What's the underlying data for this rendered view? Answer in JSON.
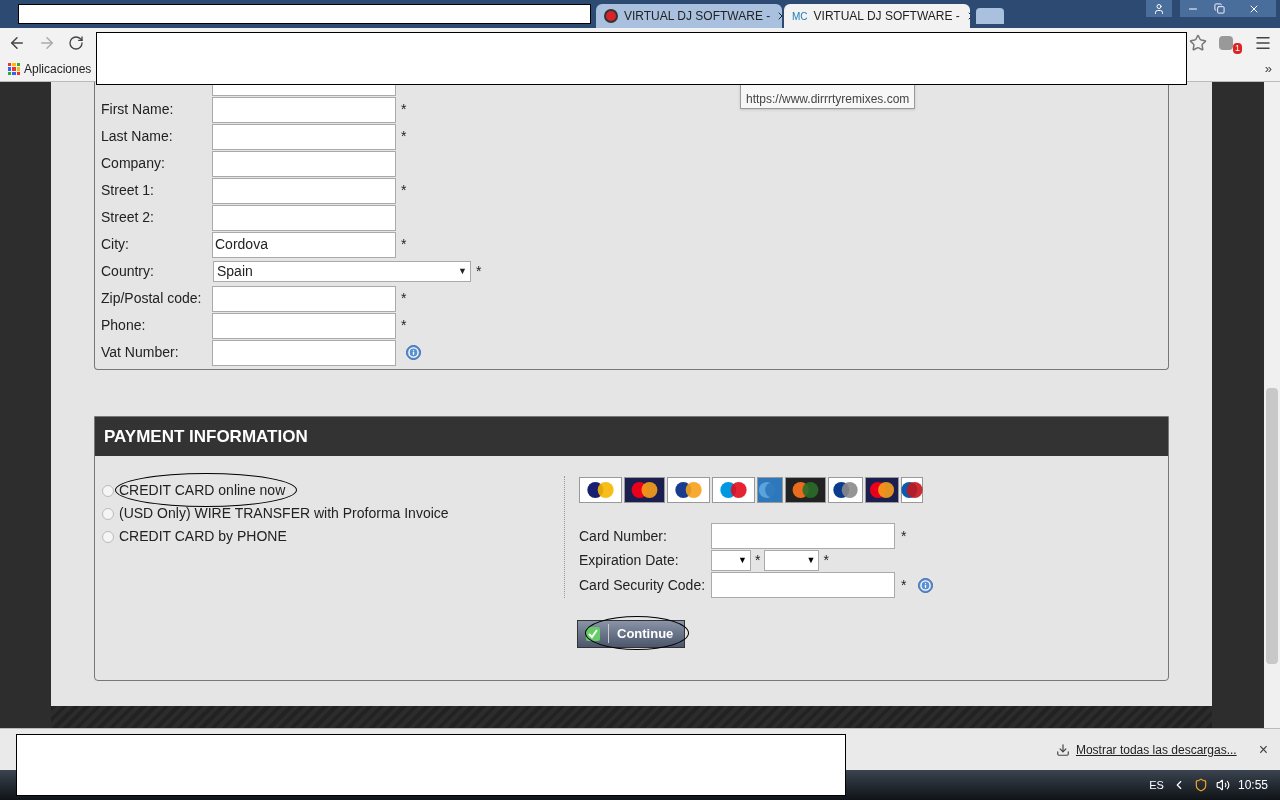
{
  "browser": {
    "tabs": [
      {
        "title": "VIRTUAL DJ SOFTWARE - ",
        "selected": false
      },
      {
        "title": "VIRTUAL DJ SOFTWARE - ",
        "favicon_text": "MC",
        "selected": true
      }
    ],
    "bookmarks": [
      {
        "label": "Aplicaciones"
      }
    ],
    "more": "»",
    "badge": "1"
  },
  "tooltip": {
    "lines": [
      "https://www.dirrrtyremixes.com"
    ]
  },
  "billing": {
    "fields": [
      {
        "label": "First Name:",
        "kind": "text",
        "mark": "*",
        "info": false
      },
      {
        "label": "Last Name:",
        "kind": "text",
        "mark": "*",
        "info": false
      },
      {
        "label": "Company:",
        "kind": "text",
        "info": false
      },
      {
        "label": "Street 1:",
        "kind": "text",
        "mark": "*",
        "info": false
      },
      {
        "label": "Street 2:",
        "kind": "text",
        "info": false
      },
      {
        "label": "City:",
        "kind": "text",
        "value": "Cordova",
        "mark": "*",
        "info": false
      },
      {
        "label": "Country:",
        "kind": "select",
        "value": "Spain",
        "arrows": [
          "▼"
        ],
        "mark": "*",
        "info": false
      },
      {
        "label": "Zip/Postal code:",
        "kind": "text",
        "mark": "*",
        "info": false
      },
      {
        "label": "Phone:",
        "kind": "text",
        "mark": "*",
        "info": false
      },
      {
        "label": "Vat Number:",
        "kind": "text",
        "info": true
      }
    ]
  },
  "payment": {
    "title": "PAYMENT INFORMATION",
    "options": [
      {
        "label": "CREDIT CARD online now",
        "selected": false,
        "circled": true
      },
      {
        "label": "(USD Only) WIRE TRANSFER with Proforma Invoice",
        "selected": false,
        "circled": false
      },
      {
        "label": "CREDIT CARD by PHONE",
        "selected": false,
        "circled": false
      }
    ],
    "card_fields": [
      {
        "label": "Card Number:",
        "kind": "text",
        "marks": [
          "*"
        ],
        "info": false
      },
      {
        "label": "Expiration Date:",
        "kind": "dates",
        "arrows": [
          "▼",
          "▼"
        ],
        "marks": [
          "*",
          "*"
        ],
        "info": false
      },
      {
        "label": "Card Security Code:",
        "kind": "text",
        "marks": [
          "*"
        ],
        "info": true
      }
    ],
    "button": {
      "label": "Continue",
      "circled": true
    }
  },
  "downloads": {
    "link": "Mostrar todas las descargas...",
    "close": "×"
  },
  "taskbar": {
    "language": "ES",
    "clock": "10:55"
  }
}
